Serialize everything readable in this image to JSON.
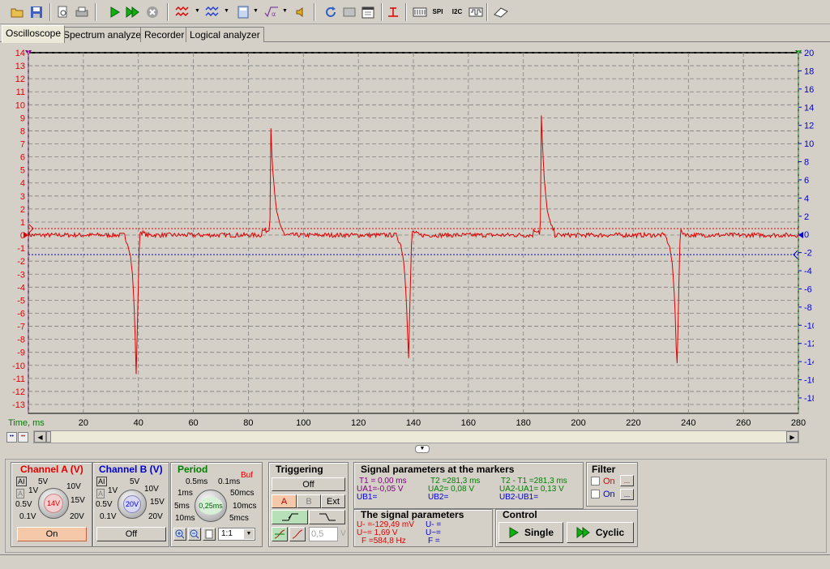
{
  "toolbar": {
    "buttons": [
      "open-icon",
      "save-icon",
      "print-preview-icon",
      "print-icon",
      "start-icon",
      "start-all-icon",
      "stop-icon",
      "generator-a-icon",
      "generator-b-icon",
      "calculator-icon",
      "math-sqrt-icon",
      "sound-icon",
      "refresh-icon",
      "screen-icon",
      "calendar-icon",
      "trigger-icon",
      "hex-1-icon",
      "spi-icon",
      "i2c-icon",
      "uart-icon",
      "eraser-icon"
    ],
    "labels": {
      "spi": "SPI",
      "i2c": "I2C"
    }
  },
  "tabs": [
    {
      "label": "Oscilloscope",
      "active": true
    },
    {
      "label": "Spectrum analyzer",
      "active": false
    },
    {
      "label": "Recorder",
      "active": false
    },
    {
      "label": "Logical analyzer",
      "active": false
    }
  ],
  "plot": {
    "colors": {
      "channel_a": "#e00000",
      "channel_b": "#0000d0",
      "marker_green": "#008000"
    },
    "left_axis": {
      "min": -13,
      "max": 14,
      "ticks": [
        "14",
        "13",
        "12",
        "11",
        "10",
        "9",
        "8",
        "7",
        "6",
        "5",
        "4",
        "3",
        "2",
        "1",
        "0",
        "-1",
        "-2",
        "-3",
        "-4",
        "-5",
        "-6",
        "-7",
        "-8",
        "-9",
        "-10",
        "-11",
        "-12",
        "-13"
      ]
    },
    "right_axis": {
      "ticks": [
        "20",
        "18",
        "16",
        "14",
        "12",
        "10",
        "8",
        "6",
        "4",
        "2",
        "0",
        "-2",
        "-4",
        "-6",
        "-8",
        "-10",
        "-12",
        "-14",
        "-16",
        "-18"
      ]
    },
    "x_axis": {
      "label": "Time, ms",
      "min": 0,
      "max": 280,
      "ticks": [
        "0",
        "20",
        "40",
        "60",
        "80",
        "100",
        "120",
        "140",
        "160",
        "180",
        "200",
        "220",
        "240",
        "260",
        "280"
      ]
    },
    "channel_a_trigger_level_v": 0.5,
    "channel_b_marker_level_v": -1.5,
    "marker_labels": {
      "left": "1",
      "right": "2"
    },
    "spikes_positive_ms": [
      87.9,
      186.4
    ],
    "spikes_negative_ms": [
      39.2,
      138.2,
      235.8
    ],
    "spike_positive_v": 10.2,
    "spike_negative_v": [
      -10.8,
      -9.9,
      -10.6
    ]
  },
  "panels": {
    "channel_a": {
      "title": "Channel A (V)",
      "scale_labels": [
        "5V",
        "10V",
        "15V",
        "20V",
        "1V",
        "0.5V",
        "0.1V"
      ],
      "value": "14V",
      "ai_label": "AI",
      "button": "On"
    },
    "channel_b": {
      "title": "Channel B (V)",
      "scale_labels": [
        "5V",
        "10V",
        "15V",
        "20V",
        "1V",
        "0.5V",
        "0.1V"
      ],
      "value": "20V",
      "ai_label": "AI",
      "button": "Off"
    },
    "period": {
      "title": "Period",
      "buf_label": "Buf",
      "scale_labels": [
        "0.5ms",
        "0.1ms",
        "1ms",
        "50mcs",
        "5ms",
        "10mcs",
        "10ms",
        "5mcs"
      ],
      "value": "0,25ms",
      "ratio": "1:1"
    },
    "triggering": {
      "title": "Triggering",
      "mode": "Off",
      "sources": [
        "A",
        "B",
        "Ext"
      ],
      "level": "0,5",
      "unit": "V"
    },
    "signal_markers": {
      "title": "Signal parameters at the markers",
      "t1": "T1 = 0,00 ms",
      "ua1": "UA1=-0,05 V",
      "ub1": "UB1=",
      "t2": "T2 =281,3 ms",
      "ua2": "UA2= 0,08 V",
      "ub2": "UB2=",
      "dt": "T2 - T1 =281,3 ms",
      "dua": "UA2-UA1= 0,13 V",
      "dub": "UB2-UB1="
    },
    "signal_params": {
      "title": "The signal parameters",
      "u_dc": "U- =-129,49 mV",
      "u_ac": "U~= 1,69 V",
      "f": "F =584,8 Hz",
      "ub_dc": "U- =",
      "ub_ac": "U~=",
      "fb": "F ="
    },
    "control": {
      "title": "Control",
      "single": "Single",
      "cyclic": "Cyclic"
    },
    "filter": {
      "title": "Filter",
      "on_a": "On",
      "on_b": "On",
      "more": "..."
    }
  }
}
